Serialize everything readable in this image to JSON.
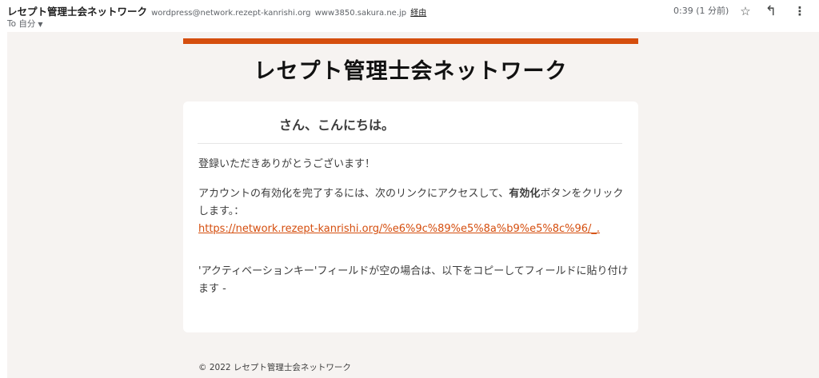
{
  "header": {
    "sender_name": "レセプト管理士会ネットワーク",
    "sender_email": "wordpress@network.rezept-kanrishi.org",
    "via_host": "www3850.sakura.ne.jp",
    "via_label": "経由",
    "to_label": "To 自分",
    "time": "0:39 (1 分前)",
    "icons": [
      "star-icon",
      "reply-icon",
      "more-vert-icon"
    ]
  },
  "email": {
    "brand_title": "レセプト管理士会ネットワーク",
    "greeting": "さん、こんにちは。",
    "thanks": "登録いただきありがとうございます！",
    "instruction_before": "アカウントの有効化を完了するには、次のリンクにアクセスして、",
    "instruction_bold": "有効化",
    "instruction_after": "ボタンをクリックします。：",
    "activation_link": "https://network.rezept-kanrishi.org/%e6%9c%89%e5%8a%b9%e5%8c%96/_.",
    "key_note": "'アクティベーションキー'フィールドが空の場合は、以下をコピーしてフィールドに貼り付けます -",
    "footer": "© 2022 レセプト管理士会ネットワーク"
  },
  "colors": {
    "accent": "#d54e0e",
    "background": "#f6f3f1",
    "card": "#ffffff"
  }
}
